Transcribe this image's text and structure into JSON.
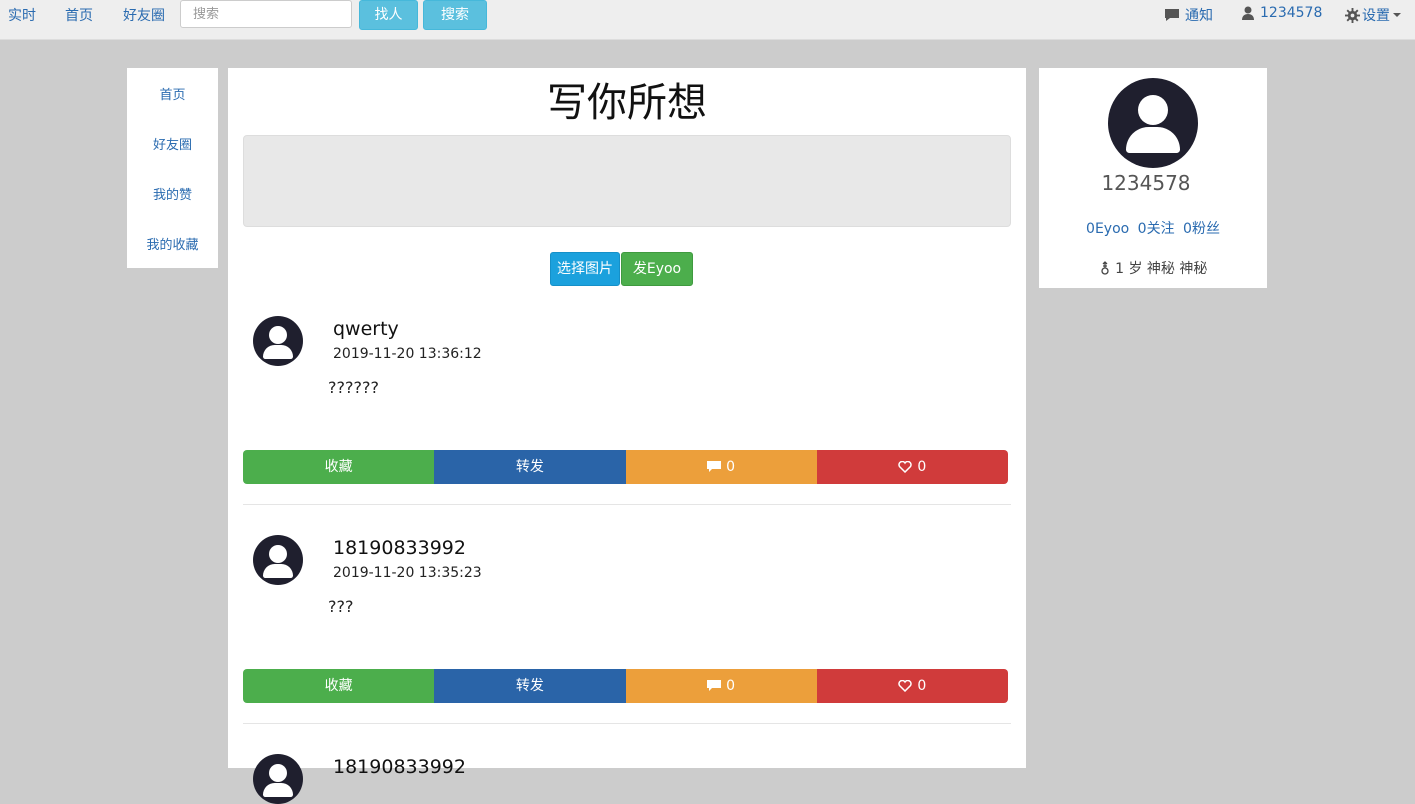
{
  "topnav": {
    "items": [
      {
        "label": "实时"
      },
      {
        "label": "首页"
      },
      {
        "label": "好友圈"
      }
    ],
    "search_placeholder": "搜索",
    "find_people_label": "找人",
    "search_button_label": "搜索",
    "notify_label": "通知",
    "user_label": "1234578",
    "settings_label": "设置"
  },
  "sidebar": {
    "items": [
      {
        "label": "首页"
      },
      {
        "label": "好友圈"
      },
      {
        "label": "我的赞"
      },
      {
        "label": "我的收藏"
      }
    ]
  },
  "composer": {
    "title": "写你所想",
    "choose_image_label": "选择图片",
    "post_label": "发Eyoo"
  },
  "posts": [
    {
      "name": "qwerty",
      "time": "2019-11-20 13:36:12",
      "text": "??????",
      "collect_label": "收藏",
      "forward_label": "转发",
      "comments": "0",
      "likes": "0"
    },
    {
      "name": "18190833992",
      "time": "2019-11-20 13:35:23",
      "text": "???",
      "collect_label": "收藏",
      "forward_label": "转发",
      "comments": "0",
      "likes": "0"
    },
    {
      "name": "18190833992"
    }
  ],
  "profile": {
    "username": "1234578",
    "eyoo_count": "0Eyoo",
    "following": "0关注",
    "followers": "0粉丝",
    "info": "1 岁 神秘 神秘"
  },
  "colors": {
    "collect": "#4cae4c",
    "forward": "#2a64a8",
    "comment": "#ec9f3b",
    "like": "#d03b3b",
    "choose_image": "#1ba1dd",
    "post": "#4cae4c"
  }
}
